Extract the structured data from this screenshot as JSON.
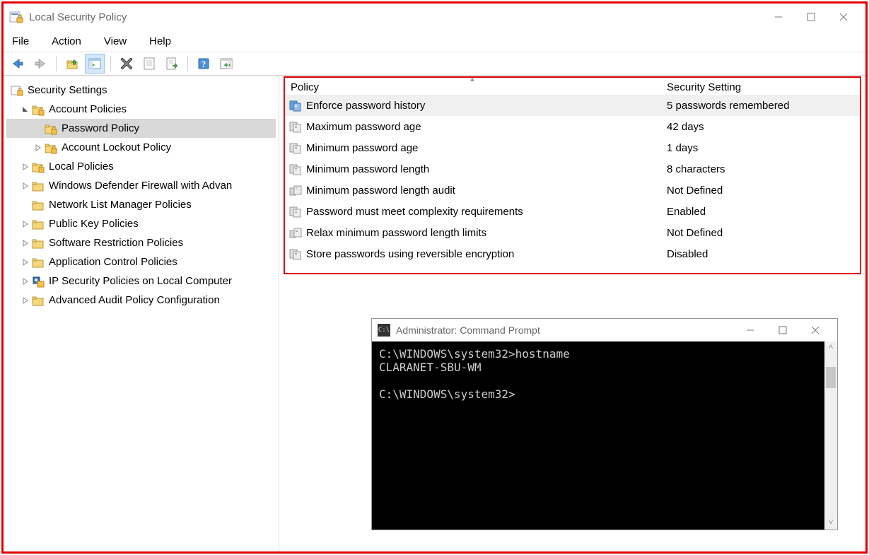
{
  "window": {
    "title": "Local Security Policy"
  },
  "menu": {
    "file": "File",
    "action": "Action",
    "view": "View",
    "help": "Help"
  },
  "tree": {
    "root": "Security Settings",
    "account_policies": "Account Policies",
    "password_policy": "Password Policy",
    "account_lockout": "Account Lockout Policy",
    "local_policies": "Local Policies",
    "firewall": "Windows Defender Firewall with Advan",
    "network_list": "Network List Manager Policies",
    "public_key": "Public Key Policies",
    "software_restrict": "Software Restriction Policies",
    "app_control": "Application Control Policies",
    "ip_security": "IP Security Policies on Local Computer",
    "advanced_audit": "Advanced Audit Policy Configuration"
  },
  "columns": {
    "policy": "Policy",
    "setting": "Security Setting"
  },
  "policies": [
    {
      "name": "Enforce password history",
      "value": "5 passwords remembered",
      "selected": true,
      "icon": "blue"
    },
    {
      "name": "Maximum password age",
      "value": "42 days",
      "icon": "gray"
    },
    {
      "name": "Minimum password age",
      "value": "1 days",
      "icon": "gray"
    },
    {
      "name": "Minimum password length",
      "value": "8 characters",
      "icon": "gray"
    },
    {
      "name": "Minimum password length audit",
      "value": "Not Defined",
      "icon": "machine"
    },
    {
      "name": "Password must meet complexity requirements",
      "value": "Enabled",
      "icon": "gray"
    },
    {
      "name": "Relax minimum password length limits",
      "value": "Not Defined",
      "icon": "machine"
    },
    {
      "name": "Store passwords using reversible encryption",
      "value": "Disabled",
      "icon": "gray"
    }
  ],
  "cmd": {
    "title": "Administrator: Command Prompt",
    "line1": "C:\\WINDOWS\\system32>hostname",
    "line2": "CLARANET-SBU-WM",
    "line3": "",
    "line4": "C:\\WINDOWS\\system32>"
  }
}
